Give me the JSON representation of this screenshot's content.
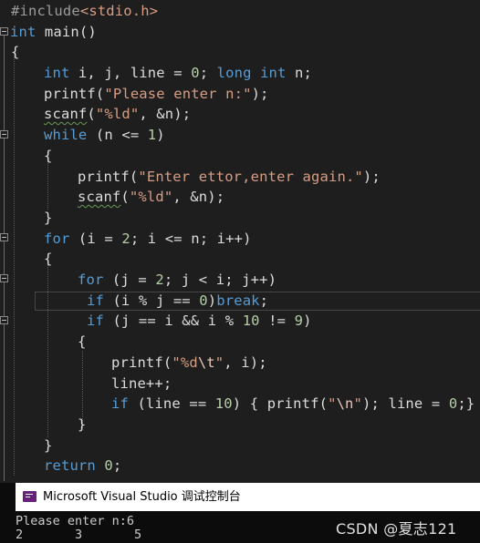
{
  "editor": {
    "lines": [
      {
        "id": "l1",
        "tokens": [
          {
            "t": "#include",
            "c": "pre"
          },
          {
            "t": "<stdio.h>",
            "c": "inc"
          }
        ]
      },
      {
        "id": "l2",
        "tokens": [
          {
            "t": "int",
            "c": "kw"
          },
          {
            "t": " main()",
            "c": "fn"
          }
        ]
      },
      {
        "id": "l3",
        "tokens": [
          {
            "t": "{",
            "c": "fn"
          }
        ]
      },
      {
        "id": "l4",
        "tokens": [
          {
            "t": "int",
            "c": "kw"
          },
          {
            "t": " i, j, line = ",
            "c": "fn"
          },
          {
            "t": "0",
            "c": "num"
          },
          {
            "t": "; ",
            "c": "fn"
          },
          {
            "t": "long",
            "c": "kw"
          },
          {
            "t": " ",
            "c": "fn"
          },
          {
            "t": "int",
            "c": "kw"
          },
          {
            "t": " n;",
            "c": "fn"
          }
        ]
      },
      {
        "id": "l5",
        "tokens": [
          {
            "t": "printf(",
            "c": "fn"
          },
          {
            "t": "\"Please enter n:\"",
            "c": "str"
          },
          {
            "t": ");",
            "c": "fn"
          }
        ]
      },
      {
        "id": "l6",
        "tokens": [
          {
            "t": "scanf",
            "c": "fn",
            "s": true
          },
          {
            "t": "(",
            "c": "fn"
          },
          {
            "t": "\"%ld\"",
            "c": "str"
          },
          {
            "t": ", &n);",
            "c": "fn"
          }
        ]
      },
      {
        "id": "l7",
        "tokens": [
          {
            "t": "while",
            "c": "kw"
          },
          {
            "t": " (n <= ",
            "c": "fn"
          },
          {
            "t": "1",
            "c": "num"
          },
          {
            "t": ")",
            "c": "fn"
          }
        ]
      },
      {
        "id": "l8",
        "tokens": [
          {
            "t": "{",
            "c": "fn"
          }
        ]
      },
      {
        "id": "l9",
        "tokens": [
          {
            "t": "printf(",
            "c": "fn"
          },
          {
            "t": "\"Enter ettor,enter again.\"",
            "c": "str"
          },
          {
            "t": ");",
            "c": "fn"
          }
        ]
      },
      {
        "id": "l10",
        "tokens": [
          {
            "t": "scanf",
            "c": "fn",
            "s": true
          },
          {
            "t": "(",
            "c": "fn"
          },
          {
            "t": "\"%ld\"",
            "c": "str"
          },
          {
            "t": ", &n);",
            "c": "fn"
          }
        ]
      },
      {
        "id": "l11",
        "tokens": [
          {
            "t": "}",
            "c": "fn"
          }
        ]
      },
      {
        "id": "l12",
        "tokens": [
          {
            "t": "for",
            "c": "kw"
          },
          {
            "t": " (i = ",
            "c": "fn"
          },
          {
            "t": "2",
            "c": "num"
          },
          {
            "t": "; i <= n; i++)",
            "c": "fn"
          }
        ]
      },
      {
        "id": "l13",
        "tokens": [
          {
            "t": "{",
            "c": "fn"
          }
        ]
      },
      {
        "id": "l14",
        "tokens": [
          {
            "t": "for",
            "c": "kw"
          },
          {
            "t": " (j = ",
            "c": "fn"
          },
          {
            "t": "2",
            "c": "num"
          },
          {
            "t": "; j < i; j++)",
            "c": "fn"
          }
        ]
      },
      {
        "id": "l15",
        "tokens": [
          {
            "t": "if",
            "c": "kw"
          },
          {
            "t": " (i % j == ",
            "c": "fn"
          },
          {
            "t": "0",
            "c": "num"
          },
          {
            "t": ")",
            "c": "fn"
          },
          {
            "t": "break",
            "c": "kw"
          },
          {
            "t": ";",
            "c": "fn"
          }
        ]
      },
      {
        "id": "l16",
        "tokens": [
          {
            "t": "if",
            "c": "kw"
          },
          {
            "t": " (j == i && i % ",
            "c": "fn"
          },
          {
            "t": "10",
            "c": "num"
          },
          {
            "t": " != ",
            "c": "fn"
          },
          {
            "t": "9",
            "c": "num"
          },
          {
            "t": ")",
            "c": "fn"
          }
        ]
      },
      {
        "id": "l17",
        "tokens": [
          {
            "t": "{",
            "c": "fn"
          }
        ]
      },
      {
        "id": "l18",
        "tokens": [
          {
            "t": "printf(",
            "c": "fn"
          },
          {
            "t": "\"%d",
            "c": "str"
          },
          {
            "t": "\\t",
            "c": "esc"
          },
          {
            "t": "\"",
            "c": "str"
          },
          {
            "t": ", i);",
            "c": "fn"
          }
        ]
      },
      {
        "id": "l19",
        "tokens": [
          {
            "t": "line++;",
            "c": "fn"
          }
        ]
      },
      {
        "id": "l20",
        "tokens": [
          {
            "t": "if",
            "c": "kw"
          },
          {
            "t": " (line == ",
            "c": "fn"
          },
          {
            "t": "10",
            "c": "num"
          },
          {
            "t": ") { printf(",
            "c": "fn"
          },
          {
            "t": "\"",
            "c": "str"
          },
          {
            "t": "\\n",
            "c": "esc"
          },
          {
            "t": "\"",
            "c": "str"
          },
          {
            "t": "); line = ",
            "c": "fn"
          },
          {
            "t": "0",
            "c": "num"
          },
          {
            "t": ";}",
            "c": "fn"
          }
        ]
      },
      {
        "id": "l21",
        "tokens": [
          {
            "t": "}",
            "c": "fn"
          }
        ]
      },
      {
        "id": "l22",
        "tokens": [
          {
            "t": "}",
            "c": "fn"
          }
        ]
      },
      {
        "id": "l23",
        "tokens": [
          {
            "t": "return",
            "c": "kw"
          },
          {
            "t": " ",
            "c": "fn"
          },
          {
            "t": "0",
            "c": "num"
          },
          {
            "t": ";",
            "c": "fn"
          }
        ]
      }
    ]
  },
  "console": {
    "title": "Microsoft Visual Studio 调试控制台",
    "output_line1": "Please enter n:6",
    "output_line2": "2       3       5"
  },
  "watermark": "CSDN @夏志121",
  "colors": {
    "keyword": "#569cd6",
    "string": "#d69d85",
    "number": "#b5cea8",
    "background": "#1e1e1e"
  }
}
